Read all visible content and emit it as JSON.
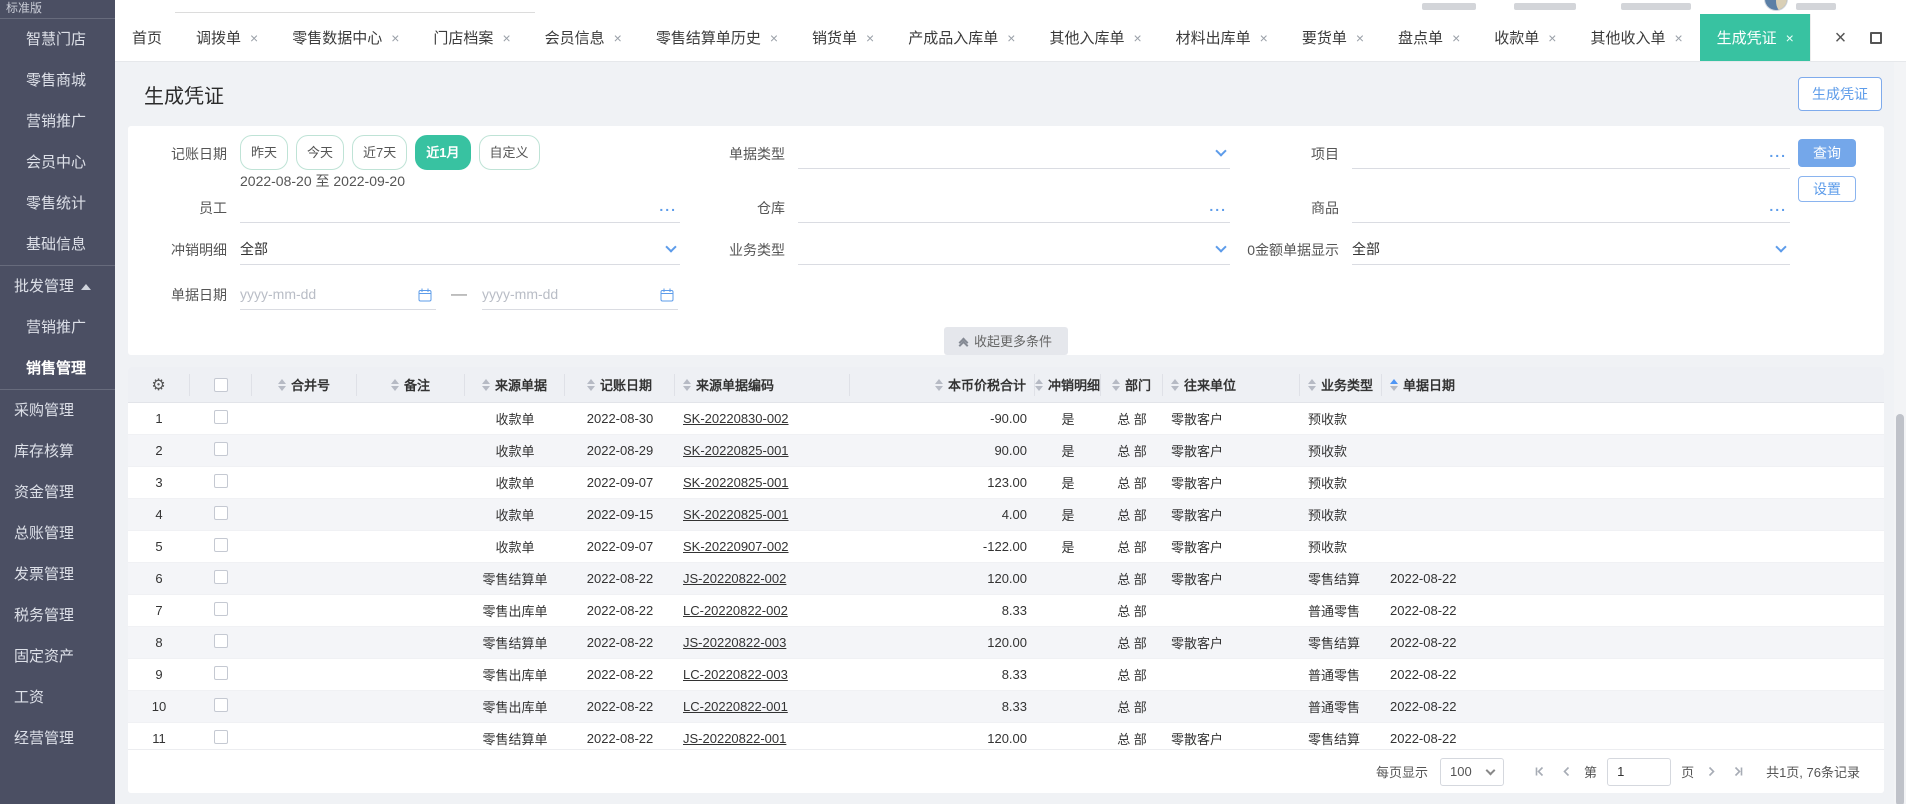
{
  "app": {
    "edition": "标准版"
  },
  "sidebar": {
    "items": [
      {
        "label": "智慧门店",
        "level": 2
      },
      {
        "label": "零售商城",
        "level": 2
      },
      {
        "label": "营销推广",
        "level": 2
      },
      {
        "label": "会员中心",
        "level": 2
      },
      {
        "label": "零售统计",
        "level": 2
      },
      {
        "label": "基础信息",
        "level": 2
      },
      {
        "divider": true
      },
      {
        "label": "批发管理",
        "level": 1,
        "expanded": true
      },
      {
        "label": "营销推广",
        "level": 2
      },
      {
        "label": "销售管理",
        "level": 2,
        "active": true
      },
      {
        "divider": true
      },
      {
        "label": "采购管理",
        "level": 1
      },
      {
        "label": "库存核算",
        "level": 1
      },
      {
        "label": "资金管理",
        "level": 1
      },
      {
        "label": "总账管理",
        "level": 1
      },
      {
        "label": "发票管理",
        "level": 1
      },
      {
        "label": "税务管理",
        "level": 1
      },
      {
        "label": "固定资产",
        "level": 1
      },
      {
        "label": "工资",
        "level": 1
      },
      {
        "label": "经营管理",
        "level": 1
      }
    ]
  },
  "tabs": {
    "items": [
      {
        "label": "首页",
        "closable": false,
        "active": false
      },
      {
        "label": "调拨单",
        "closable": true,
        "active": false
      },
      {
        "label": "零售数据中心",
        "closable": true,
        "active": false
      },
      {
        "label": "门店档案",
        "closable": true,
        "active": false
      },
      {
        "label": "会员信息",
        "closable": true,
        "active": false
      },
      {
        "label": "零售结算单历史",
        "closable": true,
        "active": false
      },
      {
        "label": "销货单",
        "closable": true,
        "active": false
      },
      {
        "label": "产成品入库单",
        "closable": true,
        "active": false
      },
      {
        "label": "其他入库单",
        "closable": true,
        "active": false
      },
      {
        "label": "材料出库单",
        "closable": true,
        "active": false
      },
      {
        "label": "要货单",
        "closable": true,
        "active": false
      },
      {
        "label": "盘点单",
        "closable": true,
        "active": false
      },
      {
        "label": "收款单",
        "closable": true,
        "active": false
      },
      {
        "label": "其他收入单",
        "closable": true,
        "active": false
      },
      {
        "label": "生成凭证",
        "closable": true,
        "active": true
      }
    ],
    "close_all": "×"
  },
  "page": {
    "title": "生成凭证",
    "generate_button": "生成凭证"
  },
  "filters": {
    "accounting_date": {
      "label": "记账日期",
      "presets": [
        "昨天",
        "今天",
        "近7天",
        "近1月",
        "自定义"
      ],
      "active_preset": "近1月",
      "range": "2022-08-20 至 2022-09-20"
    },
    "doc_type": {
      "label": "单据类型",
      "value": ""
    },
    "project": {
      "label": "项目",
      "value": ""
    },
    "employee": {
      "label": "员工",
      "value": ""
    },
    "warehouse": {
      "label": "仓库",
      "value": ""
    },
    "goods": {
      "label": "商品",
      "value": ""
    },
    "writeoff_detail": {
      "label": "冲销明细",
      "value": "全部"
    },
    "business_type": {
      "label": "业务类型",
      "value": ""
    },
    "zero_amount": {
      "label": "0金额单据显示",
      "value": "全部"
    },
    "doc_date": {
      "label": "单据日期",
      "placeholder": "yyyy-mm-dd",
      "separator": "—"
    },
    "query_button": "查询",
    "settings_button": "设置",
    "collapse_label": "收起更多条件"
  },
  "table": {
    "columns": [
      {
        "label": "合并号"
      },
      {
        "label": "备注"
      },
      {
        "label": "来源单据"
      },
      {
        "label": "记账日期"
      },
      {
        "label": "来源单据编码"
      },
      {
        "label": "本币价税合计"
      },
      {
        "label": "冲销明细"
      },
      {
        "label": "部门"
      },
      {
        "label": "往来单位"
      },
      {
        "label": "业务类型"
      },
      {
        "label": "单据日期",
        "sorted": "asc"
      }
    ],
    "rows": [
      [
        "",
        "",
        "收款单",
        "2022-08-30",
        "SK-20220830-002",
        "-90.00",
        "是",
        "总 部",
        "零散客户",
        "预收款",
        ""
      ],
      [
        "",
        "",
        "收款单",
        "2022-08-29",
        "SK-20220825-001",
        "90.00",
        "是",
        "总 部",
        "零散客户",
        "预收款",
        ""
      ],
      [
        "",
        "",
        "收款单",
        "2022-09-07",
        "SK-20220825-001",
        "123.00",
        "是",
        "总 部",
        "零散客户",
        "预收款",
        ""
      ],
      [
        "",
        "",
        "收款单",
        "2022-09-15",
        "SK-20220825-001",
        "4.00",
        "是",
        "总 部",
        "零散客户",
        "预收款",
        ""
      ],
      [
        "",
        "",
        "收款单",
        "2022-09-07",
        "SK-20220907-002",
        "-122.00",
        "是",
        "总 部",
        "零散客户",
        "预收款",
        ""
      ],
      [
        "",
        "",
        "零售结算单",
        "2022-08-22",
        "JS-20220822-002",
        "120.00",
        "",
        "总 部",
        "零散客户",
        "零售结算",
        "2022-08-22"
      ],
      [
        "",
        "",
        "零售出库单",
        "2022-08-22",
        "LC-20220822-002",
        "8.33",
        "",
        "总 部",
        "",
        "普通零售",
        "2022-08-22"
      ],
      [
        "",
        "",
        "零售结算单",
        "2022-08-22",
        "JS-20220822-003",
        "120.00",
        "",
        "总 部",
        "零散客户",
        "零售结算",
        "2022-08-22"
      ],
      [
        "",
        "",
        "零售出库单",
        "2022-08-22",
        "LC-20220822-003",
        "8.33",
        "",
        "总 部",
        "",
        "普通零售",
        "2022-08-22"
      ],
      [
        "",
        "",
        "零售出库单",
        "2022-08-22",
        "LC-20220822-001",
        "8.33",
        "",
        "总 部",
        "",
        "普通零售",
        "2022-08-22"
      ],
      [
        "",
        "",
        "零售结算单",
        "2022-08-22",
        "JS-20220822-001",
        "120.00",
        "",
        "总 部",
        "零散客户",
        "零售结算",
        "2022-08-22"
      ]
    ]
  },
  "pagination": {
    "page_size_label": "每页显示",
    "page_size": "100",
    "page_label_pre": "第",
    "page_value": "1",
    "page_label_post": "页",
    "summary": "共1页, 76条记录"
  },
  "colors": {
    "accent_green": "#38c2a1",
    "accent_blue": "#5d9cea"
  }
}
